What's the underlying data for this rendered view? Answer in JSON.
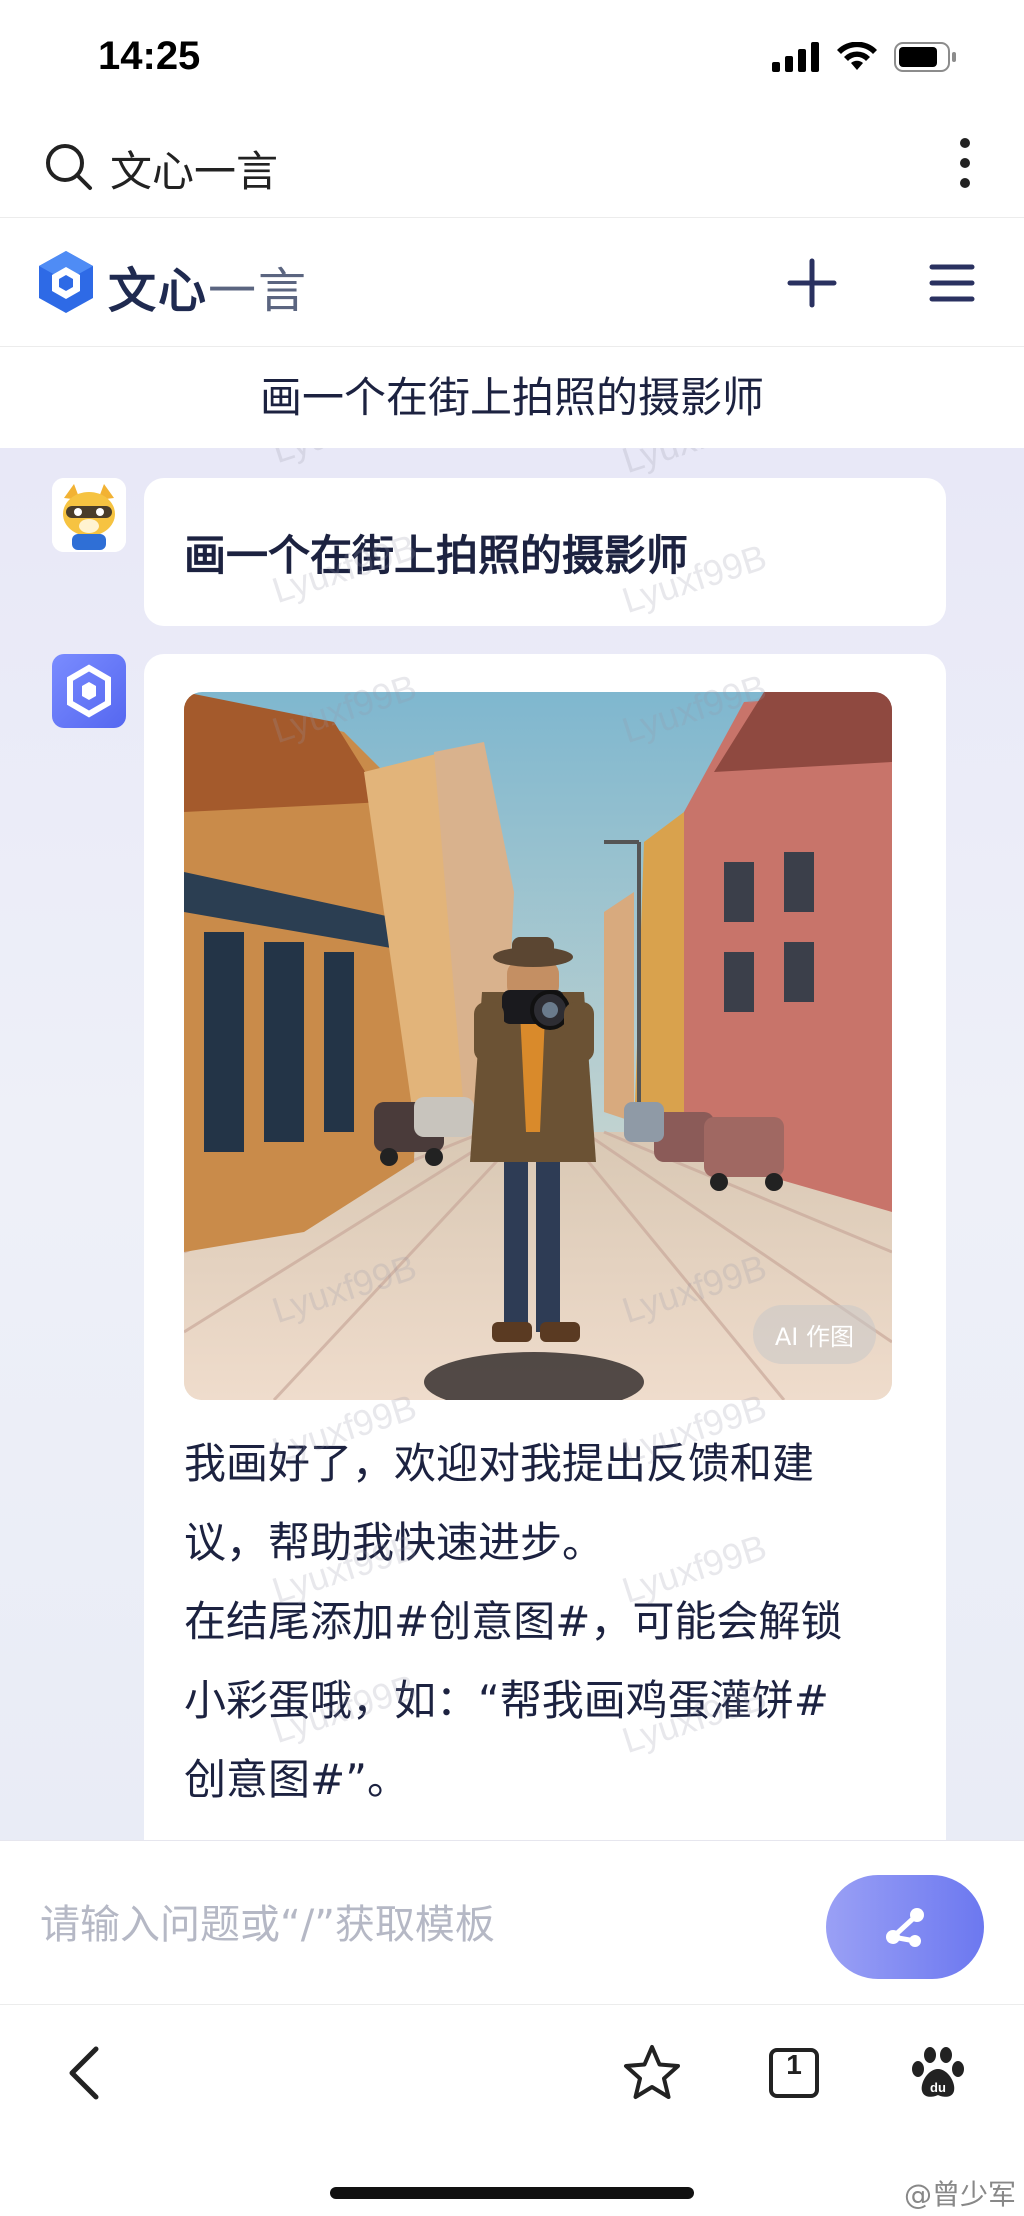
{
  "status_bar": {
    "time": "14:25"
  },
  "search": {
    "text": "文心一言"
  },
  "header": {
    "logo_main": "文心",
    "logo_sub": "一言"
  },
  "conversation": {
    "title": "画一个在街上拍照的摄影师"
  },
  "messages": {
    "user": {
      "text": "画一个在街上拍照的摄影师"
    },
    "bot": {
      "image_badge": "AI 作图",
      "reply_lines": [
        "我画好了，欢迎对我提出反馈和建",
        "议，帮助我快速进步。",
        "在结尾添加#创意图#，可能会解锁",
        "小彩蛋哦，如：“帮我画鸡蛋灌饼#",
        "创意图#”。"
      ]
    }
  },
  "watermark": "Lyuxf99B",
  "input": {
    "placeholder": "请输入问题或“/”获取模板"
  },
  "bottom_nav": {
    "tab_count": "1"
  },
  "footer": {
    "weibo_handle": "@曾少军"
  },
  "colors": {
    "accent": "#6c78f0",
    "logo_blue": "#2e6ae6",
    "text_dark": "#1c2240"
  }
}
